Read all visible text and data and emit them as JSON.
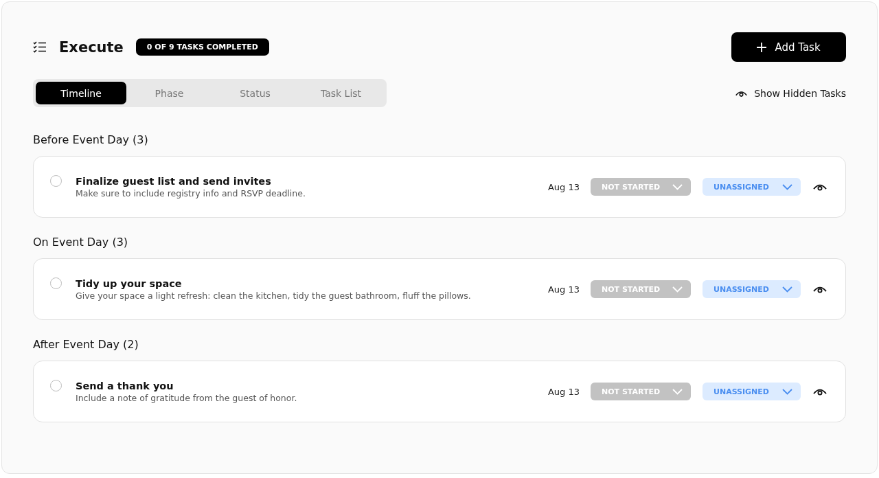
{
  "header": {
    "title": "Execute",
    "progress_badge": "0 OF 9 TASKS COMPLETED",
    "add_button": "Add Task"
  },
  "tabs": [
    {
      "label": "Timeline",
      "selected": true
    },
    {
      "label": "Phase",
      "selected": false
    },
    {
      "label": "Status",
      "selected": false
    },
    {
      "label": "Task List",
      "selected": false
    }
  ],
  "show_hidden": "Show Hidden Tasks",
  "sections": [
    {
      "title": "Before Event Day (3)",
      "tasks": [
        {
          "title": "Finalize guest list and send invites",
          "description": "Make sure to include registry info and RSVP deadline.",
          "checked": false,
          "date": "Aug 13",
          "status": "NOT STARTED",
          "assignee": "UNASSIGNED"
        }
      ]
    },
    {
      "title": "On Event Day (3)",
      "tasks": [
        {
          "title": "Tidy up your space",
          "description": "Give your space a light refresh: clean the kitchen, tidy the guest bathroom, fluff the pillows.",
          "checked": false,
          "date": "Aug 13",
          "status": "NOT STARTED",
          "assignee": "UNASSIGNED"
        }
      ]
    },
    {
      "title": "After Event Day (2)",
      "tasks": [
        {
          "title": "Send a thank you",
          "description": "Include a note of gratitude from the guest of honor.",
          "checked": false,
          "date": "Aug 13",
          "status": "NOT STARTED",
          "assignee": "UNASSIGNED"
        }
      ]
    }
  ]
}
